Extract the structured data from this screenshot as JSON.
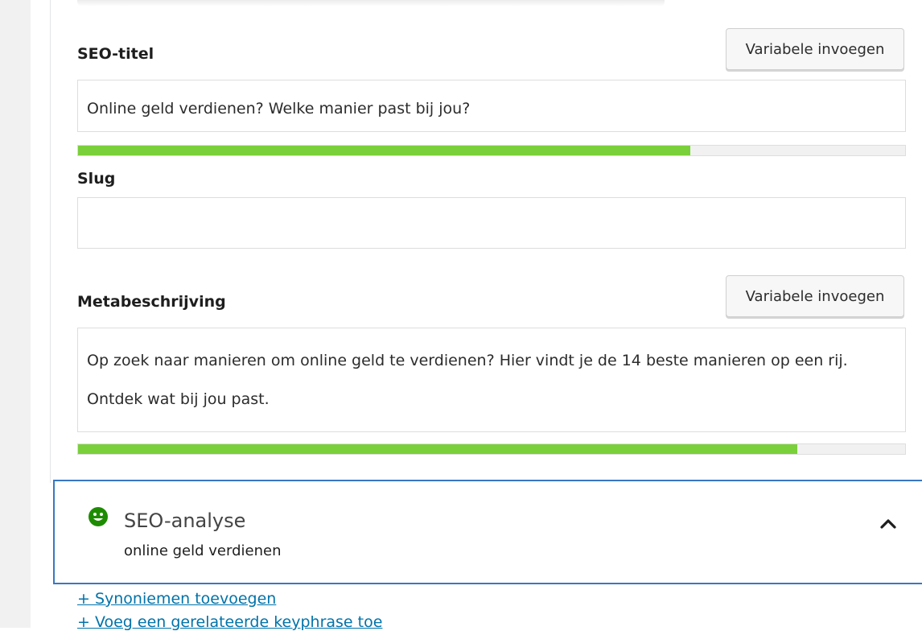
{
  "seo_title_section": {
    "label": "SEO-titel",
    "insert_variable_label": "Variabele invoegen",
    "value": "Online geld verdienen? Welke manier past bij jou?",
    "progress": 0.74
  },
  "slug_section": {
    "label": "Slug",
    "value": ""
  },
  "meta_section": {
    "label": "Metabeschrijving",
    "insert_variable_label": "Variabele invoegen",
    "value": "Op zoek naar manieren om online geld te verdienen? Hier vindt je de 14 beste manieren op een rij. Ontdek wat bij jou past.",
    "progress": 0.87
  },
  "seo_analysis": {
    "title": "SEO-analyse",
    "keyphrase": "online geld verdienen",
    "status_icon": "smiley-face-icon",
    "status_color": "#1e8c00",
    "toggle_icon": "chevron-up-icon"
  },
  "links": {
    "synonyms": "+ Synoniemen toevoegen",
    "related_keyphrase": "+ Voeg een gerelateerde keyphrase toe"
  },
  "colors": {
    "progress_good": "#7ad03a",
    "link": "#0073aa",
    "panel_border": "#3878c3"
  }
}
